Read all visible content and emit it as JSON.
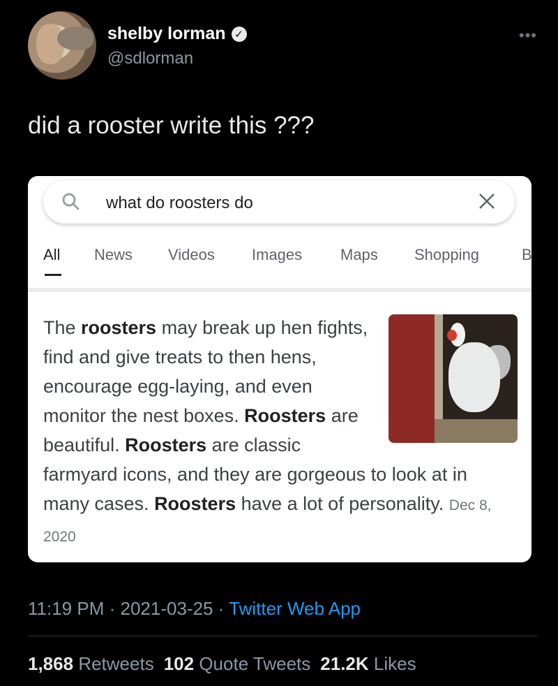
{
  "user": {
    "name": "shelby lorman",
    "handle": "@sdlorman",
    "more_icon": "more-dots-icon",
    "verified_icon": "verified-badge-icon"
  },
  "tweet": {
    "text": "did a rooster write this ???"
  },
  "card": {
    "search": {
      "query": "what do roosters do",
      "search_icon": "search-icon",
      "clear_icon": "close-icon"
    },
    "tabs": [
      "All",
      "News",
      "Videos",
      "Images",
      "Maps",
      "Shopping",
      "B"
    ],
    "active_tab": "All",
    "snippet": {
      "t1": "The ",
      "b1": "roosters",
      "t2": " may break up hen fights, find and give treats to then hens, encourage egg-laying, and even monitor the nest boxes. ",
      "b2": "Roosters",
      "t3": " are beautiful. ",
      "b3": "Roosters",
      "t4": " are classic farmyard icons, and they are gorgeous to look at in many cases. ",
      "b4": "Roosters",
      "t5": " have a lot of personality.",
      "date": "Dec 8, 2020"
    }
  },
  "meta": {
    "time": "11:19 PM",
    "sep": "·",
    "date": "2021-03-25",
    "source": "Twitter Web App"
  },
  "stats": {
    "retweets_count": "1,868",
    "retweets_label": "Retweets",
    "quotes_count": "102",
    "quotes_label": "Quote Tweets",
    "likes_count": "21.2K",
    "likes_label": "Likes"
  }
}
